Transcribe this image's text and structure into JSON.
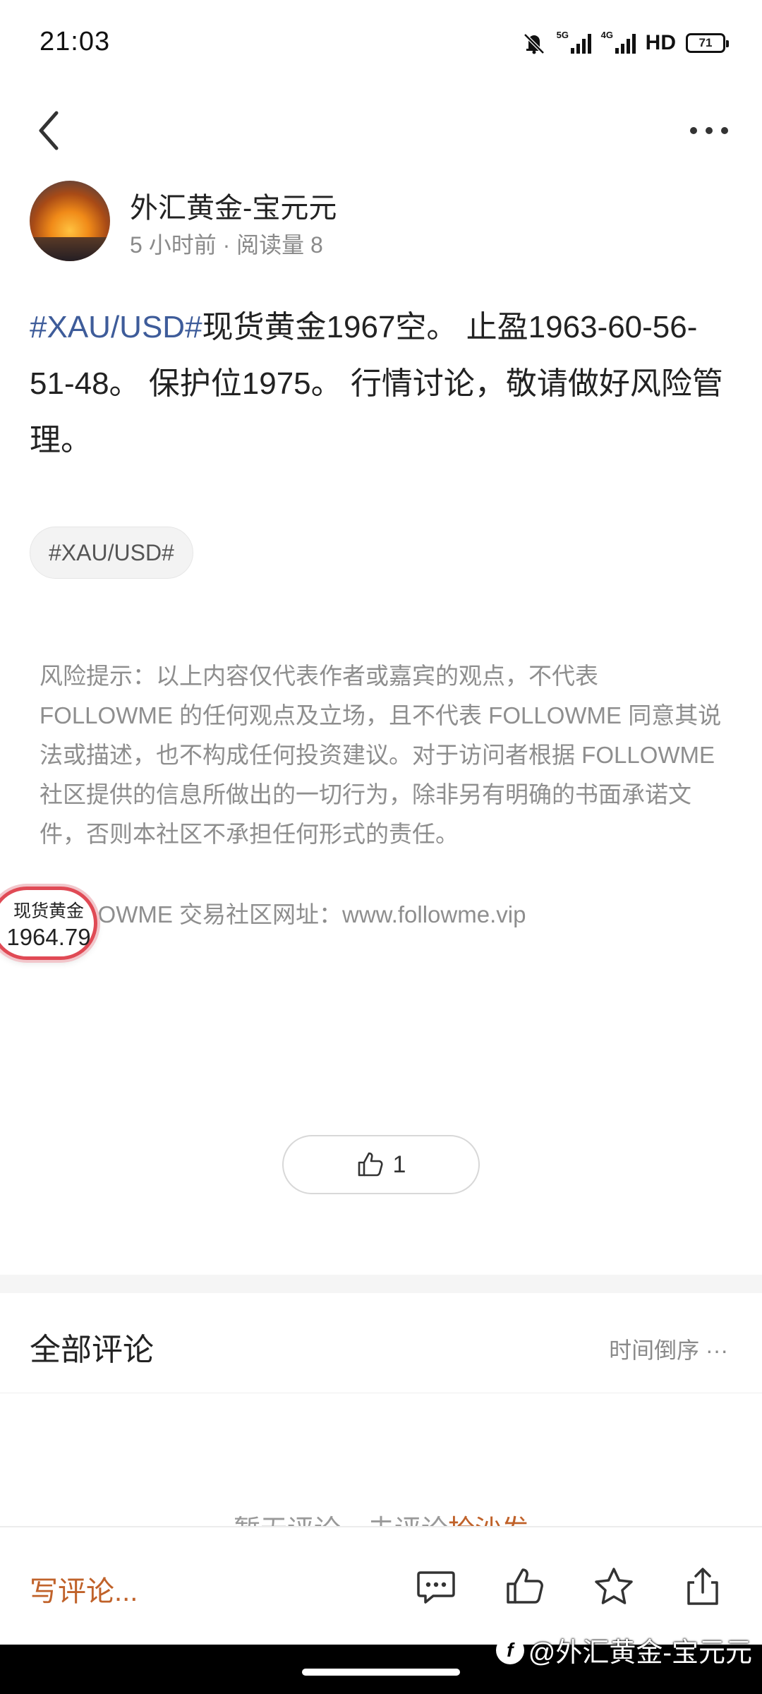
{
  "status_bar": {
    "time": "21:03",
    "net1": "5G",
    "net2": "4G",
    "hd": "HD",
    "battery": "71"
  },
  "author": {
    "name": "外汇黄金-宝元元",
    "meta": "5 小时前 · 阅读量 8"
  },
  "post": {
    "tag_link": "#XAU/USD#",
    "text": "现货黄金1967空。 止盈1963-60-56-51-48。 保护位1975。 行情讨论，敬请做好风险管理。"
  },
  "tag_chip": "#XAU/USD#",
  "risk_notice": "风险提示：以上内容仅代表作者或嘉宾的观点，不代表 FOLLOWME 的任何观点及立场，且不代表 FOLLOWME 同意其说法或描述，也不构成任何投资建议。对于访问者根据 FOLLOWME 社区提供的信息所做出的一切行为，除非另有明确的书面承诺文件，否则本社区不承担任何形式的责任。",
  "site_line": "FOLLOWME 交易社区网址：www.followme.vip",
  "gold_widget": {
    "label": "现货黄金",
    "price": "1964.79"
  },
  "like": {
    "count": "1"
  },
  "comments": {
    "title": "全部评论",
    "sort_label": "时间倒序",
    "empty_prefix": "暂无评论，去评论",
    "empty_highlight": "抢沙发"
  },
  "bottom_bar": {
    "write_comment": "写评论..."
  },
  "watermark": "@外汇黄金-宝元元",
  "icons": [
    "back-icon",
    "more-icon",
    "mute-bell-icon",
    "thumbs-up-icon",
    "comment-icon",
    "star-icon",
    "share-icon"
  ],
  "colors": {
    "tag_link": "#3e5c9a",
    "accent": "#c0622a",
    "widget_border": "#e04a55"
  }
}
